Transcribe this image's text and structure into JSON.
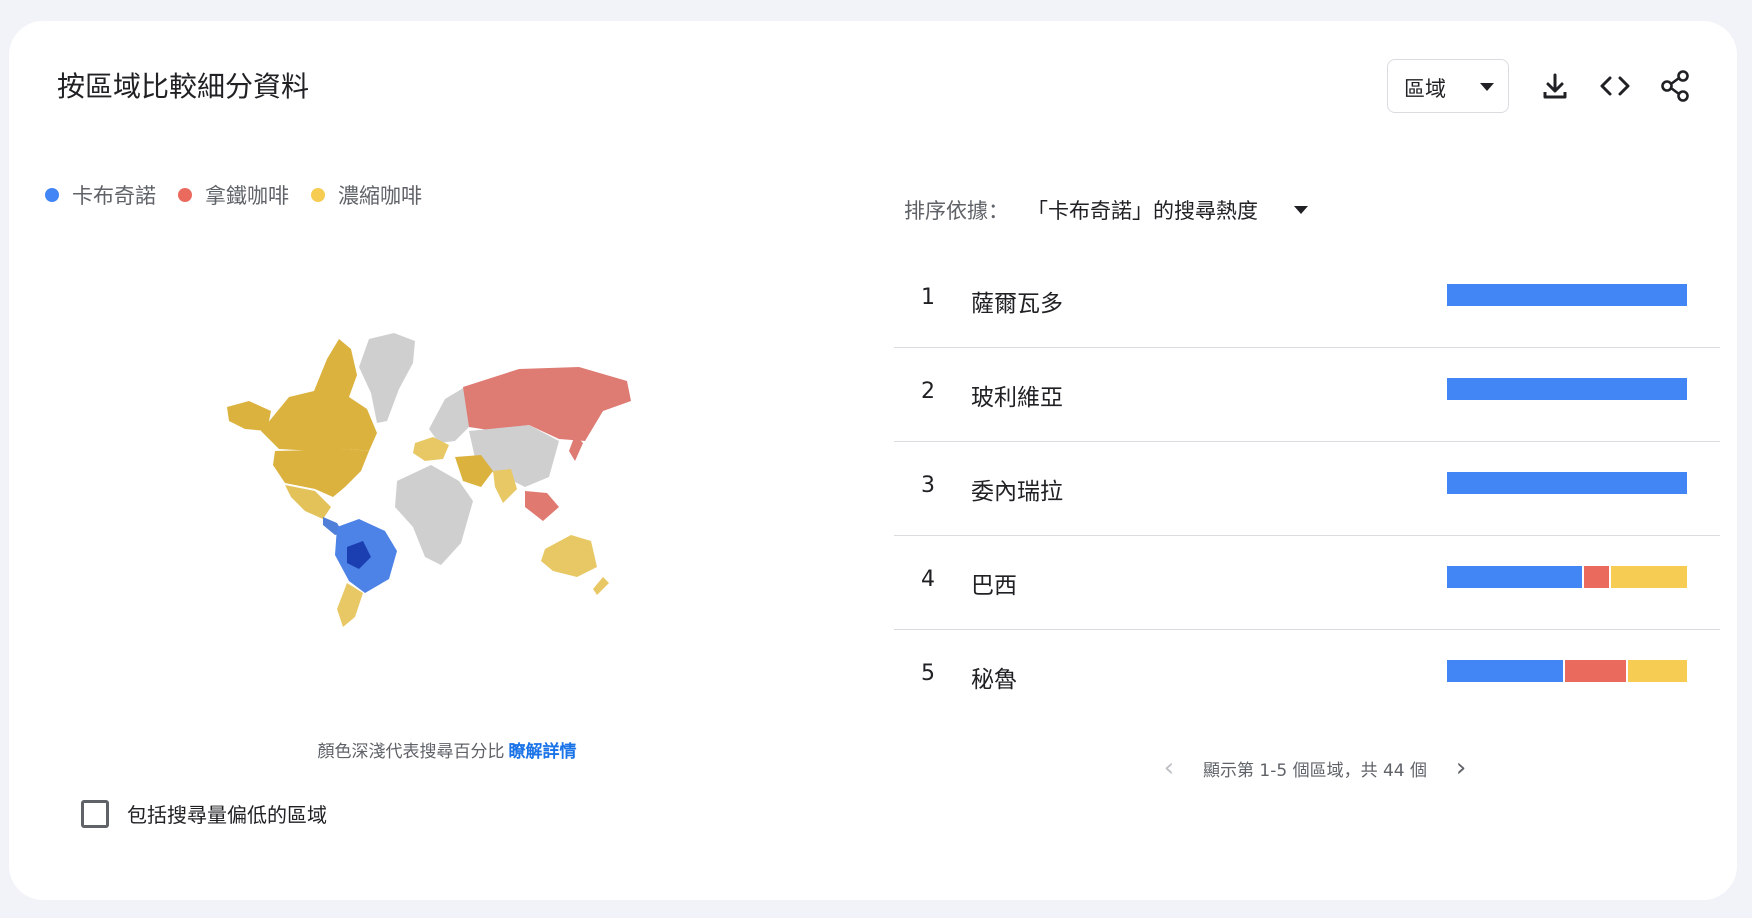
{
  "panel": {
    "title": "按區域比較細分資料",
    "region_select_label": "區域"
  },
  "legend": [
    {
      "label": "卡布奇諾",
      "color": "#4285f4"
    },
    {
      "label": "拿鐵咖啡",
      "color": "#ea6a5e"
    },
    {
      "label": "濃縮咖啡",
      "color": "#f6cd52"
    }
  ],
  "map": {
    "caption": "顏色深淺代表搜尋百分比",
    "learn_more": "瞭解詳情",
    "no_data_color": "#cfcfcf"
  },
  "include_low_volume_label": "包括搜尋量偏低的區域",
  "sort": {
    "prefix": "排序依據：",
    "value": "「卡布奇諾」的搜尋熱度"
  },
  "ranking": [
    {
      "rank": "1",
      "name": "薩爾瓦多",
      "shares": [
        1.0,
        0,
        0
      ]
    },
    {
      "rank": "2",
      "name": "玻利維亞",
      "shares": [
        1.0,
        0,
        0
      ]
    },
    {
      "rank": "3",
      "name": "委內瑞拉",
      "shares": [
        1.0,
        0,
        0
      ]
    },
    {
      "rank": "4",
      "name": "巴西",
      "shares": [
        0.57,
        0.11,
        0.32
      ]
    },
    {
      "rank": "5",
      "name": "秘魯",
      "shares": [
        0.49,
        0.26,
        0.25
      ]
    }
  ],
  "pagination": {
    "text": "顯示第 1-5 個區域，共 44 個",
    "prev_icon": "chevron-left-icon",
    "next_icon": "chevron-right-icon"
  },
  "icons": [
    "download-icon",
    "embed-code-icon",
    "share-icon",
    "dropdown-caret-icon"
  ]
}
